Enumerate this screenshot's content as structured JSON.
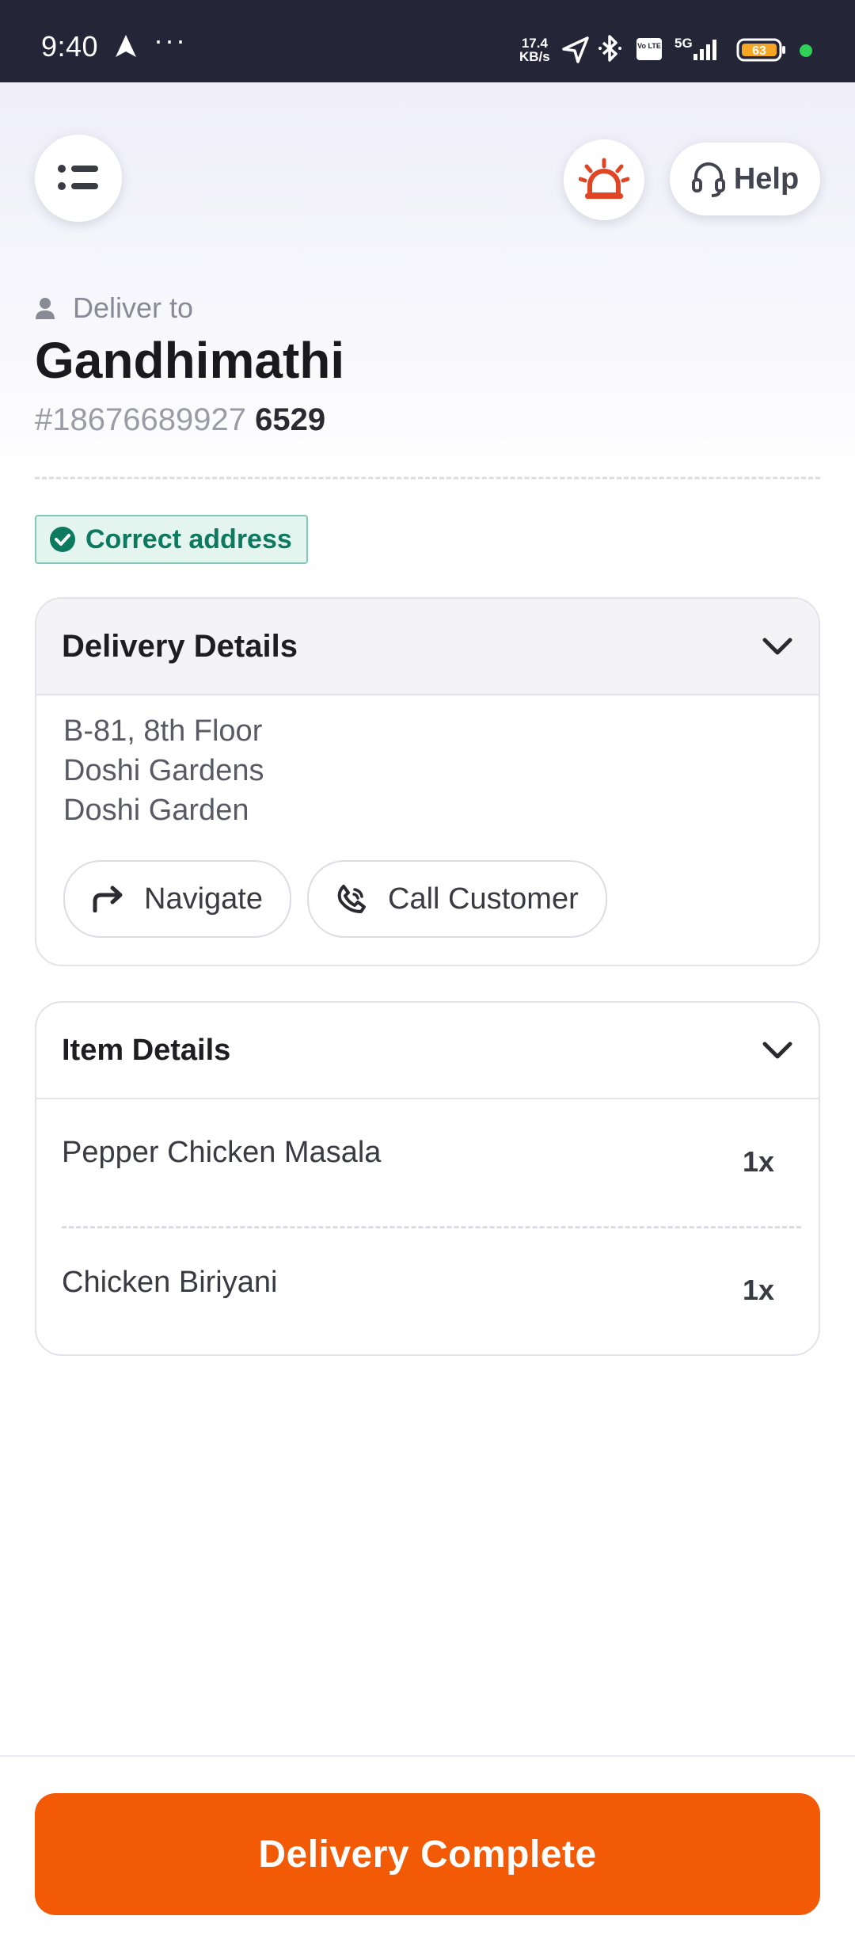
{
  "status_bar": {
    "time": "9:40",
    "more": "···",
    "net_speed_value": "17.4",
    "net_speed_unit": "KB/s",
    "network_label": "5G",
    "volte_label": "Vo LTE",
    "battery_level": "63",
    "icons": [
      "navigation-arrow-icon",
      "location-icon",
      "bluetooth-icon",
      "signal-icon",
      "battery-icon",
      "active-dot-icon"
    ]
  },
  "header": {
    "menu_icon": "list-menu-icon",
    "alert_icon": "alarm-siren-icon",
    "help_label": "Help",
    "help_icon": "headset-icon"
  },
  "customer": {
    "deliver_to_label": "Deliver to",
    "name": "Gandhimathi",
    "order_id": "#18676689927",
    "pin": "6529"
  },
  "address_badge": {
    "label": "Correct address"
  },
  "delivery_details": {
    "title": "Delivery Details",
    "address_lines": [
      "B-81, 8th Floor",
      "Doshi Gardens",
      "Doshi Garden"
    ],
    "navigate_label": "Navigate",
    "call_label": "Call Customer"
  },
  "item_details": {
    "title": "Item Details",
    "items": [
      {
        "name": "Pepper Chicken Masala",
        "qty": "1x"
      },
      {
        "name": "Chicken Biriyani",
        "qty": "1x"
      }
    ]
  },
  "footer": {
    "complete_label": "Delivery Complete"
  },
  "colors": {
    "status_bar": "#242638",
    "accent": "#f35a05",
    "success_text": "#0d7a5f",
    "success_bg": "#e4f4ef",
    "alert_icon": "#e04525"
  }
}
